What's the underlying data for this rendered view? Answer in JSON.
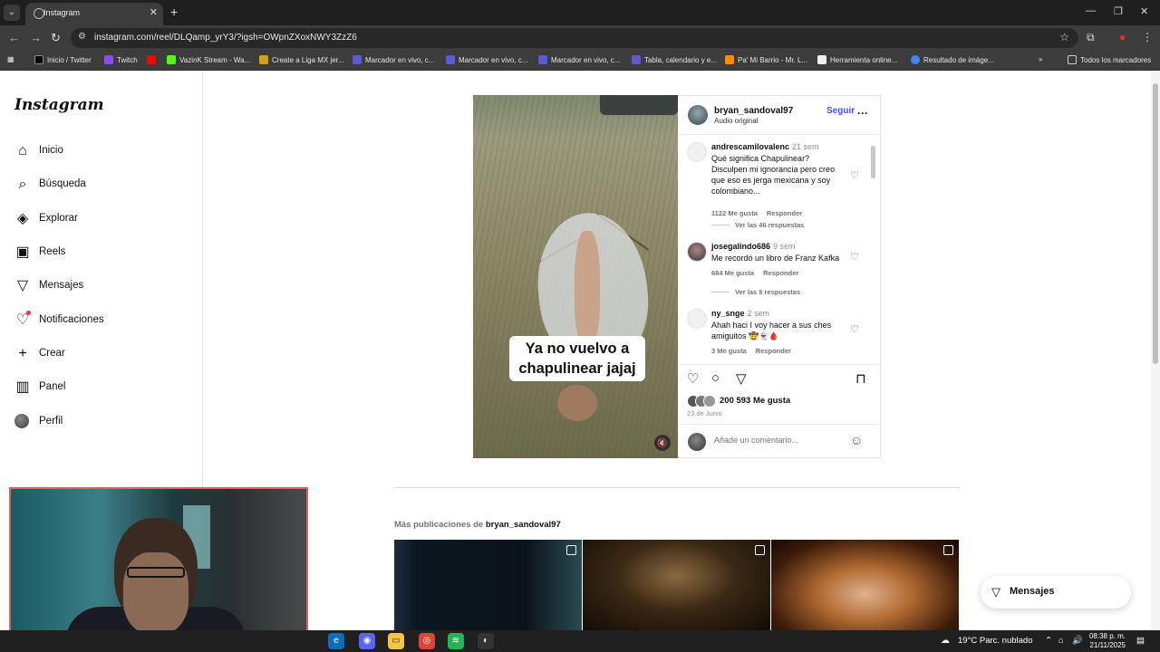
{
  "browser": {
    "tab_title": "Instagram",
    "url": "instagram.com/reel/DLQamp_yrY3/?igsh=OWpnZXoxNWY3ZzZ6",
    "bookmarks": [
      "Inicio / Twitter",
      "Twitch",
      "",
      "VazinK Stream - Wa...",
      "Create a Liga MX jer...",
      "Marcador en vivo, c...",
      "Marcador en vivo, c...",
      "Marcador en vivo, c...",
      "Tabla, calendario y e...",
      "Pa' Mi Barrio - Mr. L...",
      "Herramienta online...",
      "Resultado de imáge..."
    ],
    "all_bookmarks": "Todos los marcadores"
  },
  "sidebar": {
    "logo": "Instagram",
    "items": [
      {
        "label": "Inicio",
        "icon": "home-icon"
      },
      {
        "label": "Búsqueda",
        "icon": "search-icon"
      },
      {
        "label": "Explorar",
        "icon": "compass-icon"
      },
      {
        "label": "Reels",
        "icon": "reels-icon"
      },
      {
        "label": "Mensajes",
        "icon": "messages-icon"
      },
      {
        "label": "Notificaciones",
        "icon": "heart-icon"
      },
      {
        "label": "Crear",
        "icon": "plus-icon"
      },
      {
        "label": "Panel",
        "icon": "panel-icon"
      },
      {
        "label": "Perfil",
        "icon": "profile-avatar"
      }
    ]
  },
  "post": {
    "username": "bryan_sandoval97",
    "audio": "Audio original",
    "follow": "Seguir",
    "caption_overlay": "Ya no vuelvo a chapulinear jajaj",
    "likes": "200 593 Me gusta",
    "date": "23 de Junio",
    "add_comment_placeholder": "Añade un comentario...",
    "comments": [
      {
        "user": "andrescamilovalenc",
        "time": "21 sem",
        "text": "Qué significa Chapulinear? Disculpen mi ignorancia pero creo que eso es jerga mexicana y soy colombiano...",
        "likes": "1122 Me gusta",
        "reply": "Responder",
        "view_replies": "Ver las 46 respuestas"
      },
      {
        "user": "josegalindo686",
        "time": "9 sem",
        "text": "Me recordó un libro de Franz Kafka",
        "likes": "684 Me gusta",
        "reply": "Responder",
        "view_replies": "Ver las 5 respuestas"
      },
      {
        "user": "ny_snge",
        "time": "2 sem",
        "text": "Ahah haci I voy hacer a sus ches amiguitos 🤠👻🩸",
        "likes": "3 Me gusta",
        "reply": "Responder"
      }
    ]
  },
  "more_posts": {
    "prefix": "Más publicaciones de",
    "user": "bryan_sandoval97"
  },
  "messages_pill": "Mensajes",
  "taskbar": {
    "weather": "19°C  Parc. nublado",
    "time": "08:38 p. m.",
    "date": "21/11/2025"
  },
  "colors": {
    "accent": "#4150f7",
    "notification": "#ff3040",
    "chrome_dark": "#1f1f1f",
    "chrome_mid": "#3c3c3c"
  }
}
